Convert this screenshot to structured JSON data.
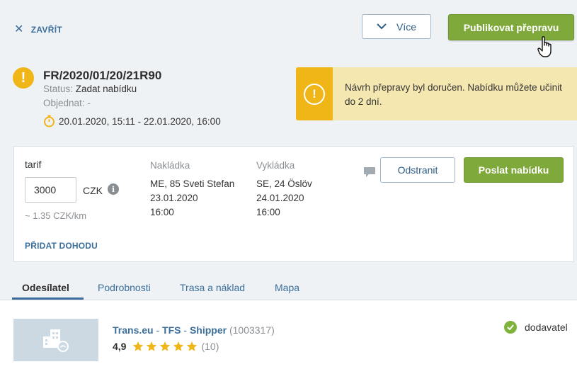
{
  "header": {
    "close_label": "ZAVŘÍT",
    "more_label": "Více",
    "publish_label": "Publikovat přepravu"
  },
  "order": {
    "id": "FR/2020/01/20/21R90",
    "status_label": "Status:",
    "status_value": "Zadat nabídku",
    "ordered_label": "Objednat:",
    "ordered_value": "-",
    "date_range": "20.01.2020, 15:11 - 22.01.2020, 16:00"
  },
  "notice": {
    "text": "Návrh přepravy byl doručen. Nabídku můžete učinit do 2 dní."
  },
  "offer": {
    "tarif_label": "tarif",
    "tarif_value": "3000",
    "currency": "CZK",
    "per_km": "~ 1.35  CZK/km",
    "add_deal_label": "PŘIDAT DOHODU",
    "loading": {
      "label": "Nakládka",
      "place": "ME, 85 Sveti Stefan",
      "date": "23.01.2020",
      "time": "16:00"
    },
    "unloading": {
      "label": "Vykládka",
      "place": "SE, 24 Öslöv",
      "date": "24.01.2020",
      "time": "16:00"
    },
    "remove_label": "Odstranit",
    "send_label": "Poslat nabídku"
  },
  "tabs": [
    {
      "label": "Odesílatel",
      "active": true
    },
    {
      "label": "Podrobnosti",
      "active": false
    },
    {
      "label": "Trasa a náklad",
      "active": false
    },
    {
      "label": "Mapa",
      "active": false
    }
  ],
  "shipper": {
    "name_1": "Trans.eu",
    "name_2": "TFS",
    "name_3": "Shipper",
    "separator": "-",
    "company_id": "(1003317)",
    "rating": "4,9",
    "stars": 5,
    "review_count": "(10)",
    "supplier_label": "dodavatel"
  },
  "colors": {
    "accent_blue": "#3b6e9b",
    "primary_green": "#7fa93b",
    "warning_yellow": "#f0b516",
    "notice_bg": "#f5e7b0",
    "star": "#f0b516"
  }
}
